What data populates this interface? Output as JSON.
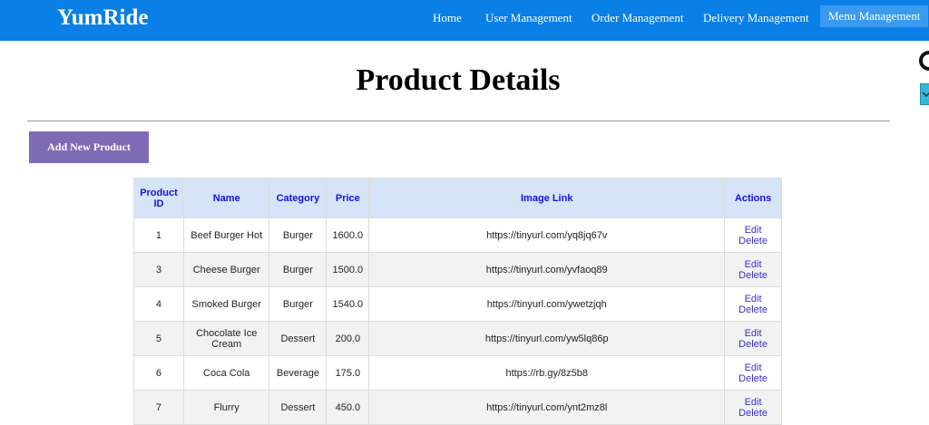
{
  "navbar": {
    "brand": "YumRide",
    "items": [
      {
        "label": "Home"
      },
      {
        "label": "User Management"
      },
      {
        "label": "Order Management"
      },
      {
        "label": "Delivery Management"
      },
      {
        "label": "Menu Management"
      }
    ],
    "active_item": "Menu Management"
  },
  "page": {
    "title": "Product Details",
    "add_button_label": "Add New Product"
  },
  "table": {
    "headers": [
      "Product ID",
      "Name",
      "Category",
      "Price",
      "Image Link",
      "Actions"
    ],
    "rows": [
      {
        "id": "1",
        "name": "Beef Burger Hot",
        "category": "Burger",
        "price": "1600.0",
        "image_link": "https://tinyurl.com/yq8jq67v"
      },
      {
        "id": "3",
        "name": "Cheese Burger",
        "category": "Burger",
        "price": "1500.0",
        "image_link": "https://tinyurl.com/yvfaoq89"
      },
      {
        "id": "4",
        "name": "Smoked Burger",
        "category": "Burger",
        "price": "1540.0",
        "image_link": "https://tinyurl.com/ywetzjqh"
      },
      {
        "id": "5",
        "name": "Chocolate Ice Cream",
        "category": "Dessert",
        "price": "200.0",
        "image_link": "https://tinyurl.com/yw5lq86p"
      },
      {
        "id": "6",
        "name": "Coca Cola",
        "category": "Beverage",
        "price": "175.0",
        "image_link": "https://rb.gy/8z5b8"
      },
      {
        "id": "7",
        "name": "Flurry",
        "category": "Dessert",
        "price": "450.0",
        "image_link": "https://tinyurl.com/ynt2mz8l"
      }
    ],
    "edit_label": "Edit",
    "delete_label": "Delete"
  },
  "colors": {
    "navbar": "#0a7fe6",
    "active_nav": "#3a9af0",
    "add_button": "#7f6bb5",
    "table_header": "#d6e4f7",
    "header_text": "#1a10e0",
    "action_link": "#3b2fc9"
  }
}
